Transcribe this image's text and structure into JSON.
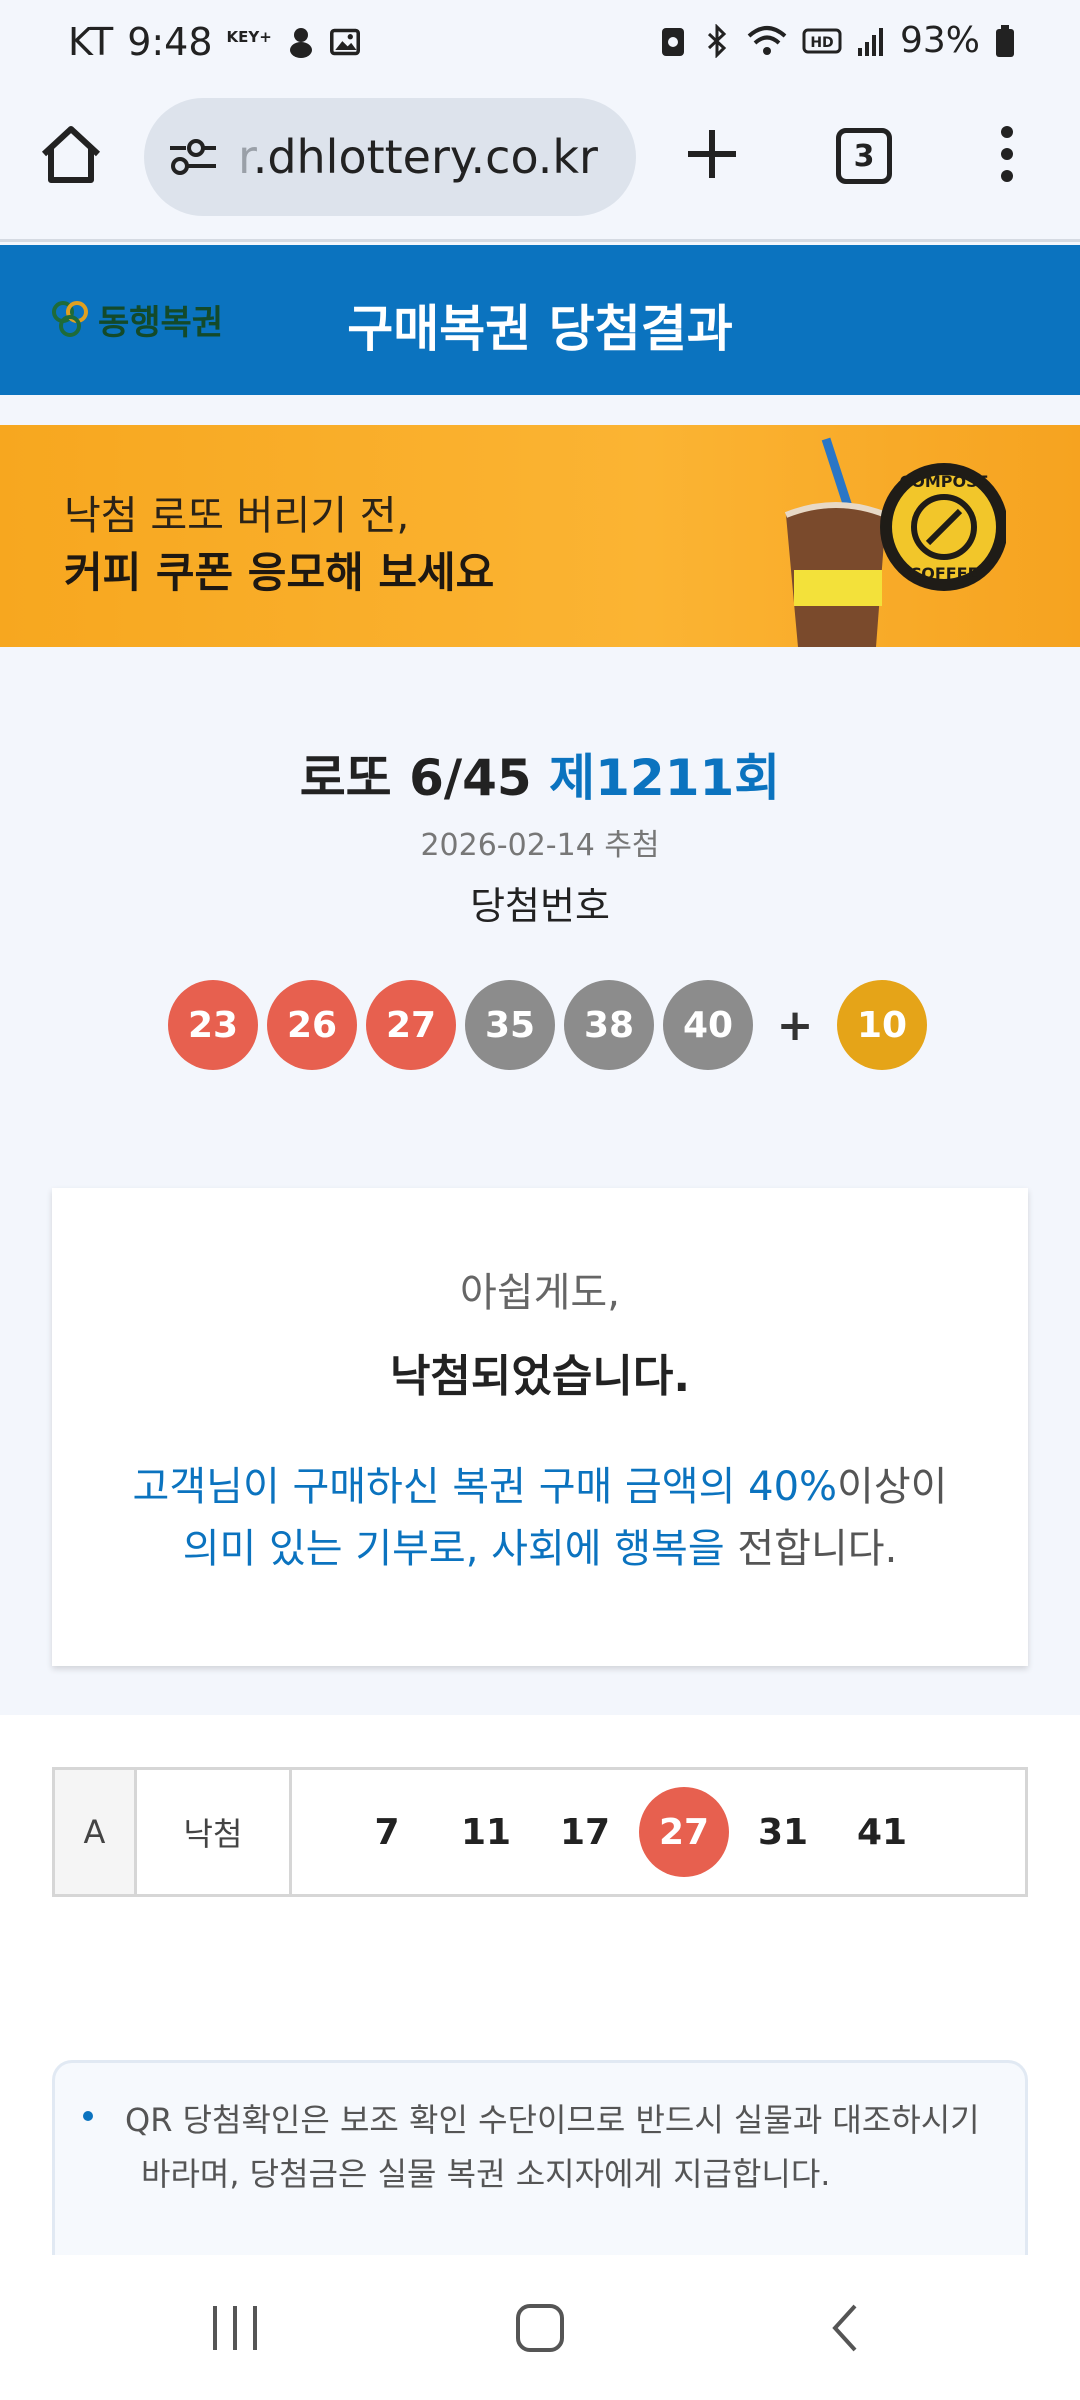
{
  "status_bar": {
    "carrier": "KT",
    "time": "9:48",
    "key_badge": "KEY+",
    "battery": "93%"
  },
  "browser": {
    "url_faded": "r",
    "url": ".dhlottery.co.kr",
    "tab_count": "3"
  },
  "header": {
    "logo_text": "동행복권",
    "title": "구매복권 당첨결과"
  },
  "banner": {
    "line1": "낙첨 로또 버리기 전,",
    "line2": "커피 쿠폰 응모해 보세요",
    "brand_line1": "COMPOSE",
    "brand_line2": "COFFEE"
  },
  "draw": {
    "game_name": "로또 6/45 ",
    "round": "제1211회",
    "date": "2026-02-14 추첨",
    "winning_label": "당첨번호",
    "numbers": [
      "23",
      "26",
      "27",
      "35",
      "38",
      "40"
    ],
    "plus": "+",
    "bonus": "10"
  },
  "message": {
    "line1": "아쉽게도,",
    "line2": "낙첨되었습니다.",
    "line3_blue": "고객님이 구매하신 복권 구매 금액의 40%",
    "line3_rest": "이상이",
    "line4_blue": "의미 있는 기부로, 사회에 행복을",
    "line4_rest": " 전합니다."
  },
  "game": {
    "label": "A",
    "result": "낙첨",
    "numbers": [
      "7",
      "11",
      "17",
      "27",
      "31",
      "41"
    ]
  },
  "notice": {
    "line1": "QR 당첨확인은 보조 확인 수단이므로 반드시 실물과 대조하시기",
    "line2": "바라며, 당첨금은 실물 복권 소지자에게 지급합니다."
  },
  "colors": {
    "brand_blue": "#0b73bf",
    "ball_red": "#e7604f",
    "ball_gray": "#8c8c8c",
    "ball_yellow": "#e5a418",
    "banner_orange": "#f7a71f"
  }
}
